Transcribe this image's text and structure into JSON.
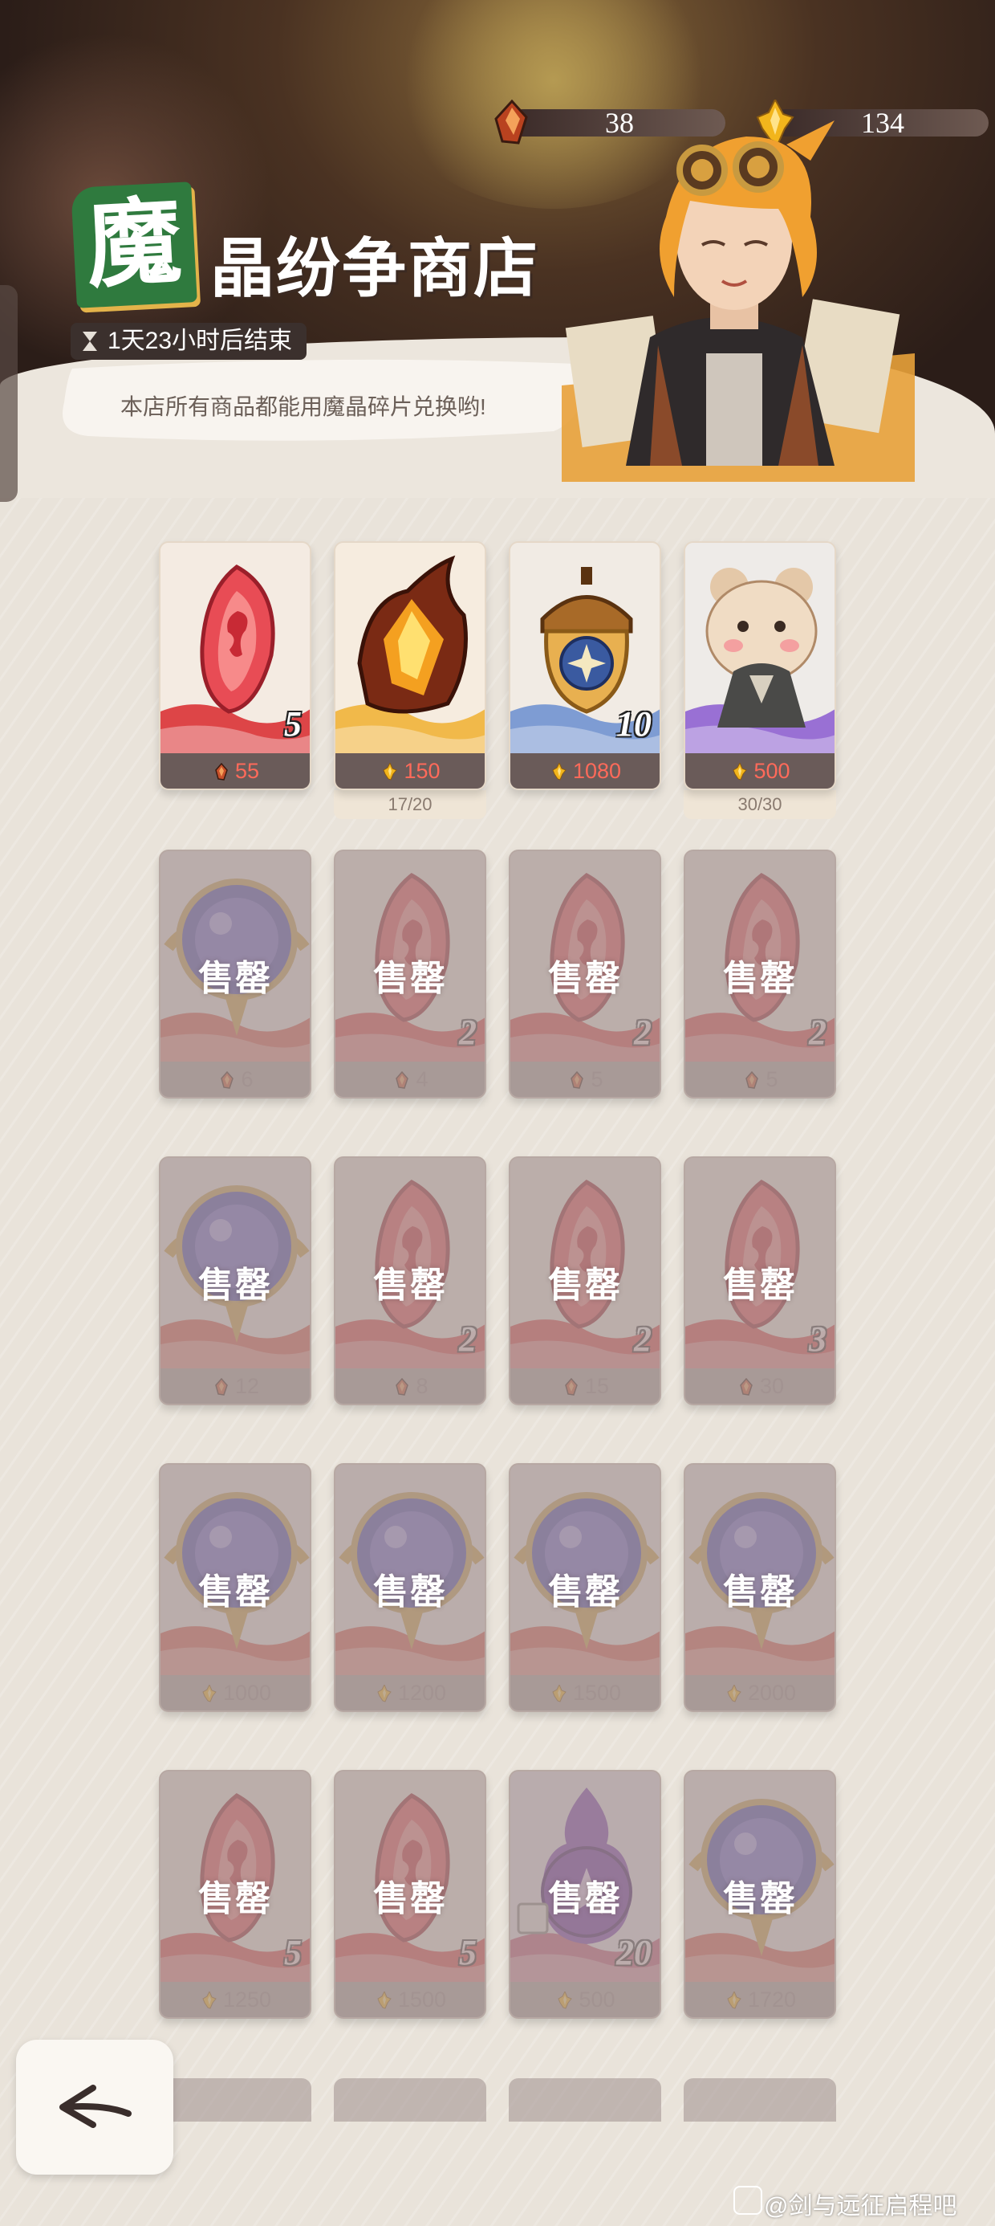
{
  "currency": {
    "crystal_shards": "38",
    "gold": "134"
  },
  "shop": {
    "badge_char": "魔",
    "title": "晶纷争商店",
    "timer": "1天23小时后结束",
    "speech": "本店所有商品都能用魔晶碎片兑换哟!"
  },
  "sold_label": "售罄",
  "rows": [
    [
      {
        "art": "red-gem",
        "qty": "5",
        "currency": "crystal",
        "price": "55",
        "stock": "",
        "sold": false
      },
      {
        "art": "flame-crystal",
        "qty": "",
        "currency": "gold",
        "price": "150",
        "stock": "17/20",
        "sold": false
      },
      {
        "art": "acorn-badge",
        "qty": "10",
        "currency": "gold",
        "price": "1080",
        "stock": "",
        "sold": false
      },
      {
        "art": "hamster-portrait",
        "qty": "",
        "currency": "gold",
        "price": "500",
        "stock": "30/30",
        "sold": false
      }
    ],
    [
      {
        "art": "orb",
        "qty": "",
        "currency": "crystal",
        "price": "6",
        "stock": "",
        "sold": true
      },
      {
        "art": "red-gem",
        "qty": "2",
        "currency": "crystal",
        "price": "4",
        "stock": "",
        "sold": true
      },
      {
        "art": "red-gem",
        "qty": "2",
        "currency": "crystal",
        "price": "5",
        "stock": "",
        "sold": true
      },
      {
        "art": "red-gem",
        "qty": "2",
        "currency": "crystal",
        "price": "5",
        "stock": "",
        "sold": true
      }
    ],
    [
      {
        "art": "orb",
        "qty": "",
        "currency": "crystal",
        "price": "12",
        "stock": "",
        "sold": true
      },
      {
        "art": "red-gem",
        "qty": "2",
        "currency": "crystal",
        "price": "8",
        "stock": "",
        "sold": true
      },
      {
        "art": "red-gem",
        "qty": "2",
        "currency": "crystal",
        "price": "15",
        "stock": "",
        "sold": true
      },
      {
        "art": "red-gem",
        "qty": "3",
        "currency": "crystal",
        "price": "30",
        "stock": "",
        "sold": true
      }
    ],
    [
      {
        "art": "orb",
        "qty": "",
        "currency": "gold",
        "price": "1000",
        "stock": "",
        "sold": true
      },
      {
        "art": "orb",
        "qty": "",
        "currency": "gold",
        "price": "1200",
        "stock": "",
        "sold": true
      },
      {
        "art": "orb",
        "qty": "",
        "currency": "gold",
        "price": "1500",
        "stock": "",
        "sold": true
      },
      {
        "art": "orb",
        "qty": "",
        "currency": "gold",
        "price": "2000",
        "stock": "",
        "sold": true
      }
    ],
    [
      {
        "art": "red-gem",
        "qty": "5",
        "currency": "gold",
        "price": "1250",
        "stock": "",
        "sold": true
      },
      {
        "art": "red-gem",
        "qty": "5",
        "currency": "gold",
        "price": "1500",
        "stock": "",
        "sold": true
      },
      {
        "art": "purple-flame-orb",
        "qty": "20",
        "currency": "gold",
        "price": "500",
        "stock": "",
        "sold": true
      },
      {
        "art": "orb",
        "qty": "",
        "currency": "gold",
        "price": "1720",
        "stock": "",
        "sold": true
      }
    ]
  ],
  "partial_row_count": 4,
  "watermark": "@剑与远征启程吧",
  "icons": {
    "back": "back-arrow-icon",
    "crystal": "crystal-shard-icon",
    "gold": "gold-coin-icon",
    "timer": "hourglass-icon"
  }
}
